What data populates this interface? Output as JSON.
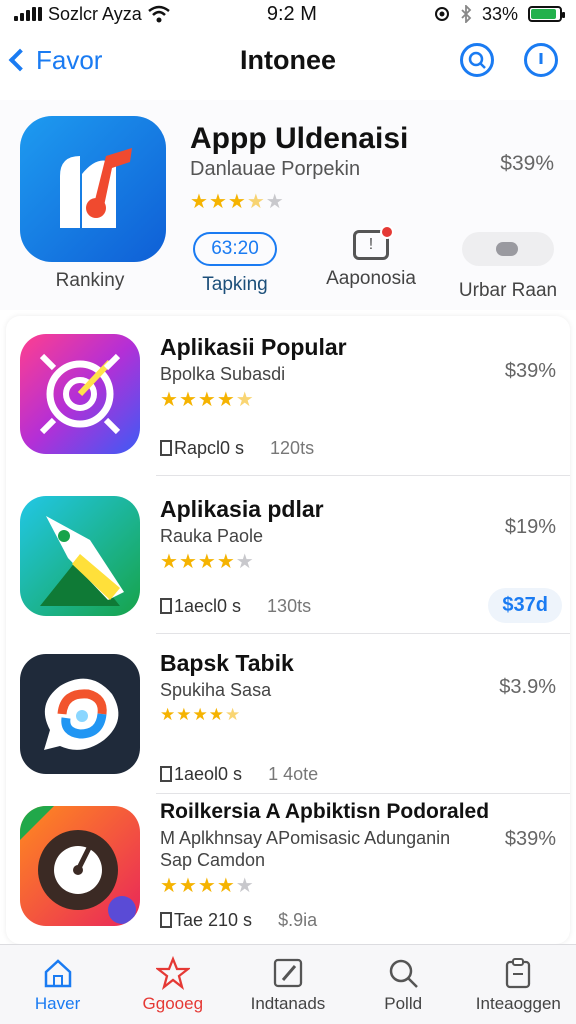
{
  "status": {
    "carrier": "Sozlcr Ayza",
    "time": "9:2 M",
    "battery": "33%",
    "battery_level": 0.9
  },
  "nav": {
    "back_label": "Favor",
    "title": "Intonee"
  },
  "featured": {
    "title": "Appp Uldenaisi",
    "subtitle": "Danlauae Porpekin",
    "price": "$39%",
    "rating": 3.5,
    "actions": [
      {
        "label": "Rankiny",
        "pill": "63:20"
      },
      {
        "label": "Tapking"
      },
      {
        "label": "Aaponosia"
      },
      {
        "label": "Urbar Raan"
      }
    ]
  },
  "apps": [
    {
      "title": "Aplikasii Popular",
      "subtitle": "Bpolka Subasdi",
      "price": "$39%",
      "rating": 4.5,
      "meta1": "Rapcl0  s",
      "meta2": "120ts"
    },
    {
      "title": "Aplikasia pdlar",
      "subtitle": "Rauka Paole",
      "price": "$19%",
      "rating": 4,
      "meta1": "1aecl0  s",
      "meta2": "130ts",
      "button": "$37d"
    },
    {
      "title": "Bapsk Tabik",
      "subtitle": "Spukiha Sasa",
      "price": "$3.9%",
      "rating": 4.5,
      "meta1": "1aeol0  s",
      "meta2": "1 4ote"
    },
    {
      "title": "Roilkersia A Apbiktisn Podoraled",
      "subtitle": "M Aplkhnsay APomisasic Adunganin",
      "subtitle2": "Sap Camdon",
      "price": "$39%",
      "rating": 4,
      "meta1": "Tae 210  s",
      "meta2": "$.9ia"
    }
  ],
  "tabs": [
    {
      "label": "Haver",
      "icon": "home-icon"
    },
    {
      "label": "Ggooeg",
      "icon": "star-icon"
    },
    {
      "label": "Indtanads",
      "icon": "edit-icon"
    },
    {
      "label": "Polld",
      "icon": "search-icon"
    },
    {
      "label": "Inteaoggen",
      "icon": "clipboard-icon"
    }
  ],
  "colors": {
    "accent": "#1a7bf2",
    "star": "#f5b301",
    "badge": "#e53935"
  }
}
